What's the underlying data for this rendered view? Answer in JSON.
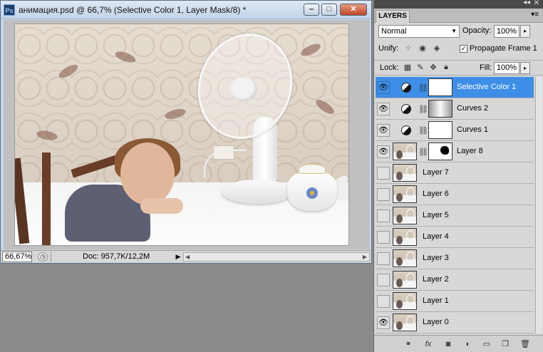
{
  "document": {
    "title": "анимация.psd @ 66,7% (Selective Color 1, Layer Mask/8) *",
    "app_icon": "Ps",
    "window_buttons": {
      "minimize": "‒",
      "maximize": "□",
      "close": "✕"
    },
    "status": {
      "zoom": "66,67%",
      "doc_info": "Doc: 957,7K/12,2M",
      "arrow": "▶"
    }
  },
  "panel": {
    "tab_label": "LAYERS",
    "blend_mode": "Normal",
    "opacity_label": "Opacity:",
    "opacity_value": "100%",
    "unify_label": "Unify:",
    "propagate_label": "Propagate Frame 1",
    "propagate_checked": "✓",
    "lock_label": "Lock:",
    "fill_label": "Fill:",
    "fill_value": "100%"
  },
  "layers": [
    {
      "name": "Selective Color 1",
      "visible": true,
      "type": "adjustment",
      "selected": true
    },
    {
      "name": "Curves 2",
      "visible": true,
      "type": "adjustment",
      "selected": false
    },
    {
      "name": "Curves 1",
      "visible": true,
      "type": "adjustment",
      "selected": false
    },
    {
      "name": "Layer 8",
      "visible": true,
      "type": "image-mask",
      "selected": false
    },
    {
      "name": "Layer 7",
      "visible": false,
      "type": "image",
      "selected": false
    },
    {
      "name": "Layer 6",
      "visible": false,
      "type": "image",
      "selected": false
    },
    {
      "name": "Layer 5",
      "visible": false,
      "type": "image",
      "selected": false
    },
    {
      "name": "Layer 4",
      "visible": false,
      "type": "image",
      "selected": false
    },
    {
      "name": "Layer 3",
      "visible": false,
      "type": "image",
      "selected": false
    },
    {
      "name": "Layer 2",
      "visible": false,
      "type": "image",
      "selected": false
    },
    {
      "name": "Layer 1",
      "visible": false,
      "type": "image",
      "selected": false
    },
    {
      "name": "Layer 0",
      "visible": true,
      "type": "image",
      "selected": false
    }
  ],
  "colors": {
    "selection": "#3d8ee6",
    "panel_bg": "#d6d6d6",
    "title_bg": "#c9d8ea"
  }
}
